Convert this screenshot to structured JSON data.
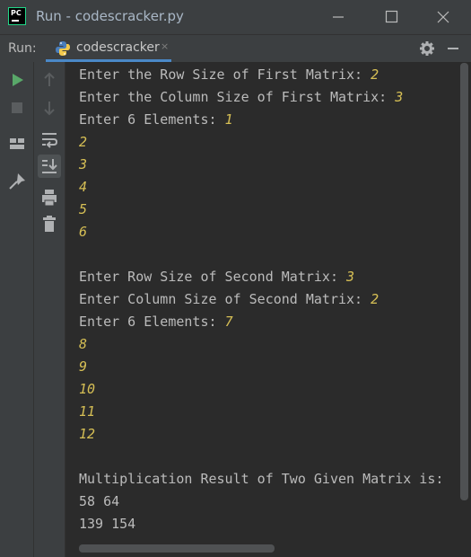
{
  "window": {
    "logo_text": "PC",
    "title": "Run - codescracker.py"
  },
  "run_panel": {
    "label": "Run:",
    "tab_label": "codescracker",
    "tab_close": "×"
  },
  "console": {
    "lines": [
      {
        "prompt": "Enter the Row Size of First Matrix: ",
        "input": "2"
      },
      {
        "prompt": "Enter the Column Size of First Matrix: ",
        "input": "3"
      },
      {
        "prompt": "Enter 6 Elements: ",
        "input": "1"
      },
      {
        "prompt": "",
        "input": "2"
      },
      {
        "prompt": "",
        "input": "3"
      },
      {
        "prompt": "",
        "input": "4"
      },
      {
        "prompt": "",
        "input": "5"
      },
      {
        "prompt": "",
        "input": "6"
      },
      {
        "prompt": "",
        "input": ""
      },
      {
        "prompt": "Enter Row Size of Second Matrix: ",
        "input": "3"
      },
      {
        "prompt": "Enter Column Size of Second Matrix: ",
        "input": "2"
      },
      {
        "prompt": "Enter 6 Elements: ",
        "input": "7"
      },
      {
        "prompt": "",
        "input": "8"
      },
      {
        "prompt": "",
        "input": "9"
      },
      {
        "prompt": "",
        "input": "10"
      },
      {
        "prompt": "",
        "input": "11"
      },
      {
        "prompt": "",
        "input": "12"
      },
      {
        "prompt": "",
        "input": ""
      },
      {
        "prompt": "Multiplication Result of Two Given Matrix is:",
        "input": ""
      },
      {
        "prompt": "58 64",
        "input": ""
      },
      {
        "prompt": "139 154",
        "input": ""
      }
    ]
  },
  "icons": {
    "title_bar": [
      "pycharm-logo-icon",
      "minimize-icon",
      "maximize-icon",
      "close-icon"
    ],
    "run_bar": [
      "python-icon",
      "gear-icon",
      "hide-panel-icon"
    ],
    "left_toolbar_1": [
      "rerun-icon",
      "stop-icon",
      "layout-icon",
      "pin-icon"
    ],
    "left_toolbar_2": [
      "up-arrow-icon",
      "down-arrow-icon",
      "soft-wrap-icon",
      "scroll-to-end-icon",
      "print-icon",
      "trash-icon"
    ]
  },
  "colors": {
    "background": "#2b2b2b",
    "chrome": "#3c3f41",
    "output_text": "#bbbbbb",
    "user_input": "#d6bf55",
    "run_green": "#59a869",
    "tab_underline": "#4a88c7"
  }
}
